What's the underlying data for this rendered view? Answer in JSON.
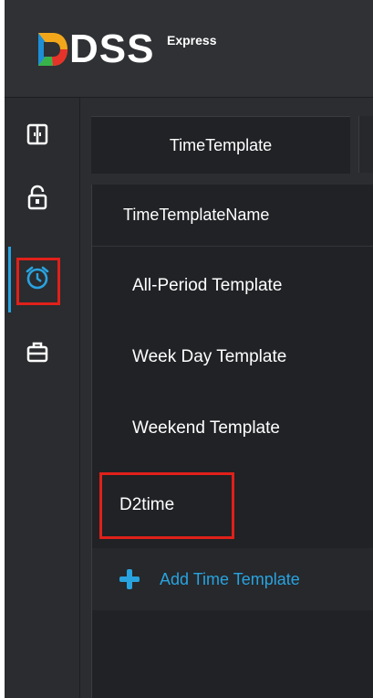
{
  "header": {
    "logo_text": "DSS",
    "logo_sup": "Express"
  },
  "sidebar": {
    "items": [
      {
        "icon": "door-icon",
        "active": false
      },
      {
        "icon": "lock-icon",
        "active": false
      },
      {
        "icon": "alarm-clock-icon",
        "active": true
      },
      {
        "icon": "briefcase-icon",
        "active": false
      }
    ]
  },
  "tabs": [
    {
      "label": "TimeTemplate",
      "active": true
    }
  ],
  "list": {
    "header": "TimeTemplateName",
    "items": [
      {
        "label": "All-Period Template"
      },
      {
        "label": "Week Day Template"
      },
      {
        "label": "Weekend Template"
      },
      {
        "label": "D2time"
      }
    ],
    "add_label": "Add Time Template"
  },
  "colors": {
    "accent": "#29a3e0",
    "highlight": "#e0201a",
    "background": "#2b2d30",
    "panel": "#202225"
  }
}
